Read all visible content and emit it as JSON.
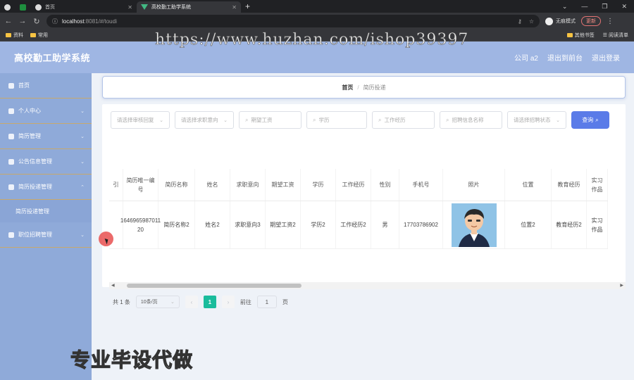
{
  "browser": {
    "tabs": [
      {
        "label": "",
        "icon": "globe-icon"
      },
      {
        "label": "",
        "icon": "spreadsheet-icon"
      },
      {
        "label": "首页",
        "icon": "globe-icon"
      },
      {
        "label": "高校勤工助学系统",
        "icon": "vue-icon",
        "active": true
      }
    ],
    "url_host": "localhost",
    "url_path": ":8081/#/toudi",
    "incognito_label": "无痕模式",
    "update_label": "更新",
    "bookmarks": [
      "资料",
      "常用"
    ],
    "bookmarks_right": [
      "其他书签",
      "阅读清单"
    ]
  },
  "watermark_url": "https://www.huzhan.com/ishop39397",
  "watermark_bottom": "专业毕设代做",
  "app": {
    "title": "高校勤工助学系统",
    "header_links": [
      "公司 a2",
      "退出到前台",
      "退出登录"
    ]
  },
  "sidebar": {
    "items": [
      {
        "label": "首页",
        "icon": "home-icon"
      },
      {
        "label": "个人中心",
        "icon": "user-icon"
      },
      {
        "label": "简历管理",
        "icon": "document-icon"
      },
      {
        "label": "公告信息管理",
        "icon": "notice-icon"
      },
      {
        "label": "简历投递管理",
        "icon": "folder-icon"
      },
      {
        "label": "职位招聘管理",
        "icon": "briefcase-icon"
      }
    ],
    "sub_item": "简历投递管理"
  },
  "breadcrumb": {
    "home": "首页",
    "current": "简历投递"
  },
  "filters": {
    "review_status": "请选择审核回复",
    "job_intent": "请选择求职意向",
    "expected_salary": "期望工资",
    "education": "学历",
    "work_experience": "工作经历",
    "recruit_name": "招聘信息名称",
    "recruit_status": "请选择招聘状态",
    "query_button": "查询"
  },
  "table": {
    "headers": [
      "引",
      "简历唯一编号",
      "简历名称",
      "姓名",
      "求职意向",
      "期望工资",
      "学历",
      "工作经历",
      "性别",
      "手机号",
      "照片",
      "位置",
      "教育经历",
      "实习作品"
    ],
    "row": [
      "",
      "1646965987011 20",
      "简历名称2",
      "姓名2",
      "求职意向3",
      "期望工资2",
      "学历2",
      "工作经历2",
      "男",
      "17703786902",
      "",
      "位置2",
      "教育经历2",
      "实习作品"
    ]
  },
  "pagination": {
    "total": "共 1 条",
    "page_size": "10条/页",
    "current_page": "1",
    "goto_label": "前往",
    "goto_value": "1",
    "page_suffix": "页"
  }
}
